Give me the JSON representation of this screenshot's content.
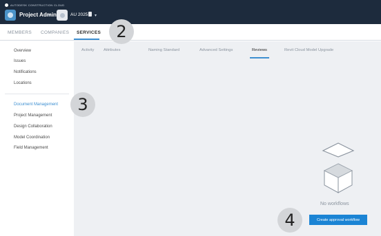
{
  "topbar": {
    "brand": "AUTODESK CONSTRUCTION CLOUD",
    "app_title": "Project Admin",
    "caret": "▾",
    "project_name": "AU 2025",
    "app_icon": "product-icon",
    "project_icon": "project-thumbnail-icon",
    "doc_icon": "document-icon"
  },
  "tabs": [
    {
      "label": "MEMBERS"
    },
    {
      "label": "COMPANIES"
    },
    {
      "label": "SERVICES"
    }
  ],
  "sidebar": {
    "items": [
      {
        "label": "Overview"
      },
      {
        "label": "Issues"
      },
      {
        "label": "Notifications"
      },
      {
        "label": "Locations"
      },
      {
        "label": "Document Management"
      },
      {
        "label": "Project Management"
      },
      {
        "label": "Design Collaboration"
      },
      {
        "label": "Model Coordination"
      },
      {
        "label": "Field Management"
      }
    ]
  },
  "subtabs": [
    {
      "label": "Activity"
    },
    {
      "label": "Attributes"
    },
    {
      "label": "Naming Standard"
    },
    {
      "label": "Advanced Settings"
    },
    {
      "label": "Reviews"
    },
    {
      "label": "Revit Cloud Model Upgrade"
    }
  ],
  "empty_state": {
    "text": "No workflows",
    "illustration": "empty-box-icon",
    "button_label": "Create approval workflow"
  },
  "callouts": [
    "2",
    "3",
    "4"
  ],
  "colors": {
    "topbar": "#1d2b3d",
    "accent": "#3d8fd1",
    "button": "#1b84d4",
    "content_bg": "#eef0f3"
  }
}
